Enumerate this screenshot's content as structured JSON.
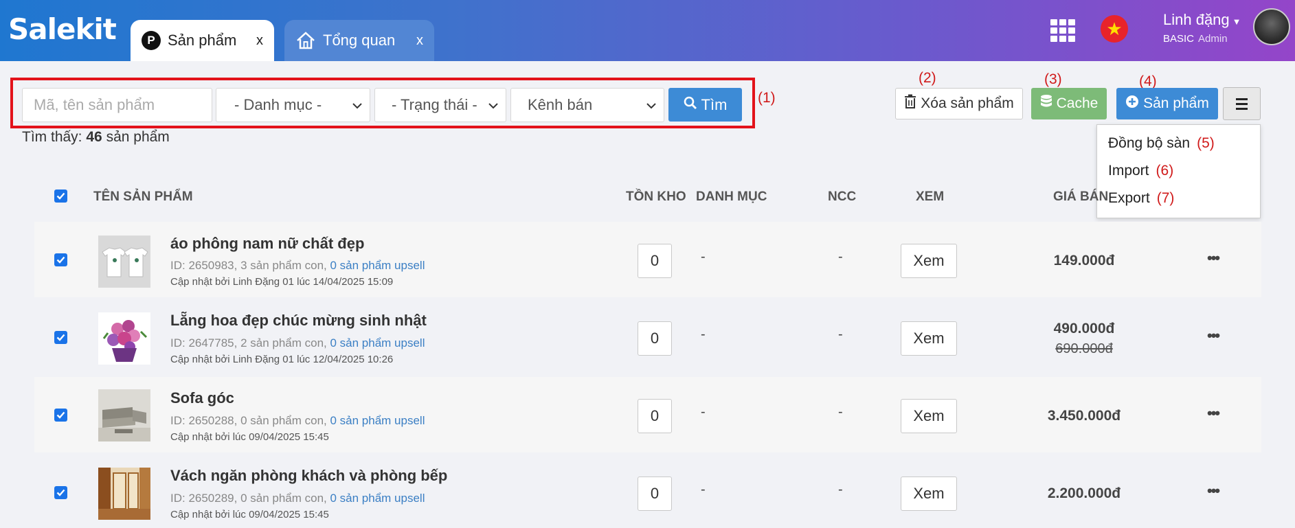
{
  "header": {
    "logo": "Salekit",
    "tabs": [
      {
        "label": "Sản phẩm",
        "close": "x",
        "icon_letter": "P"
      },
      {
        "label": "Tổng quan",
        "close": "x"
      }
    ],
    "user_name": "Linh đặng",
    "plan": "BASIC",
    "role": "Admin",
    "flag_star": "★"
  },
  "filters": {
    "search_placeholder": "Mã, tên sản phẩm",
    "category": "- Danh mục -",
    "status": "- Trạng thái -",
    "channel": "Kênh bán",
    "search_button": "Tìm"
  },
  "toolbar": {
    "delete_label": "Xóa sản phẩm",
    "cache_label": "Cache",
    "add_label": "Sản phẩm"
  },
  "annotations": {
    "a1": "(1)",
    "a2": "(2)",
    "a3": "(3)",
    "a4": "(4)",
    "a5": "(5)",
    "a6": "(6)",
    "a7": "(7)"
  },
  "menu": {
    "items": [
      {
        "label": "Đồng bộ sàn",
        "tag": "(5)"
      },
      {
        "label": "Import",
        "tag": "(6)"
      },
      {
        "label": "Export",
        "tag": "(7)"
      }
    ]
  },
  "summary": {
    "prefix": "Tìm thấy:",
    "count": "46",
    "suffix": "sản phẩm"
  },
  "table": {
    "columns": {
      "name": "TÊN SẢN PHẨM",
      "stock": "TỒN KHO",
      "category": "DANH MỤC",
      "supplier": "NCC",
      "view": "XEM",
      "price": "GIÁ BÁN"
    },
    "rows": [
      {
        "name": "áo phông nam nữ chất đẹp",
        "id_text": "ID: 2650983, 3 sản phẩm con,",
        "upsell": "0 sản phẩm upsell",
        "updated": "Cập nhật bởi Linh Đặng 01 lúc 14/04/2025 15:09",
        "stock": "0",
        "category": "-",
        "supplier": "-",
        "view": "Xem",
        "price": "149.000đ",
        "old_price": "",
        "more": "•••"
      },
      {
        "name": "Lẵng hoa đẹp chúc mừng sinh nhật",
        "id_text": "ID: 2647785, 2 sản phẩm con,",
        "upsell": "0 sản phẩm upsell",
        "updated": "Cập nhật bởi Linh Đặng 01 lúc 12/04/2025 10:26",
        "stock": "0",
        "category": "-",
        "supplier": "-",
        "view": "Xem",
        "price": "490.000đ",
        "old_price": "690.000đ",
        "more": "•••"
      },
      {
        "name": "Sofa góc",
        "id_text": "ID: 2650288, 0 sản phẩm con,",
        "upsell": "0 sản phẩm upsell",
        "updated": "Cập nhật bởi lúc 09/04/2025 15:45",
        "stock": "0",
        "category": "-",
        "supplier": "-",
        "view": "Xem",
        "price": "3.450.000đ",
        "old_price": "",
        "more": "•••"
      },
      {
        "name": "Vách ngăn phòng khách và phòng bếp",
        "id_text": "ID: 2650289, 0 sản phẩm con,",
        "upsell": "0 sản phẩm upsell",
        "updated": "Cập nhật bởi lúc 09/04/2025 15:45",
        "stock": "0",
        "category": "-",
        "supplier": "-",
        "view": "Xem",
        "price": "2.200.000đ",
        "old_price": "",
        "more": "•••"
      }
    ]
  },
  "colors": {
    "primary": "#3d8bd6",
    "success": "#7dbb78",
    "annotation_red": "#d01a1a",
    "link": "#3b7fc4"
  }
}
